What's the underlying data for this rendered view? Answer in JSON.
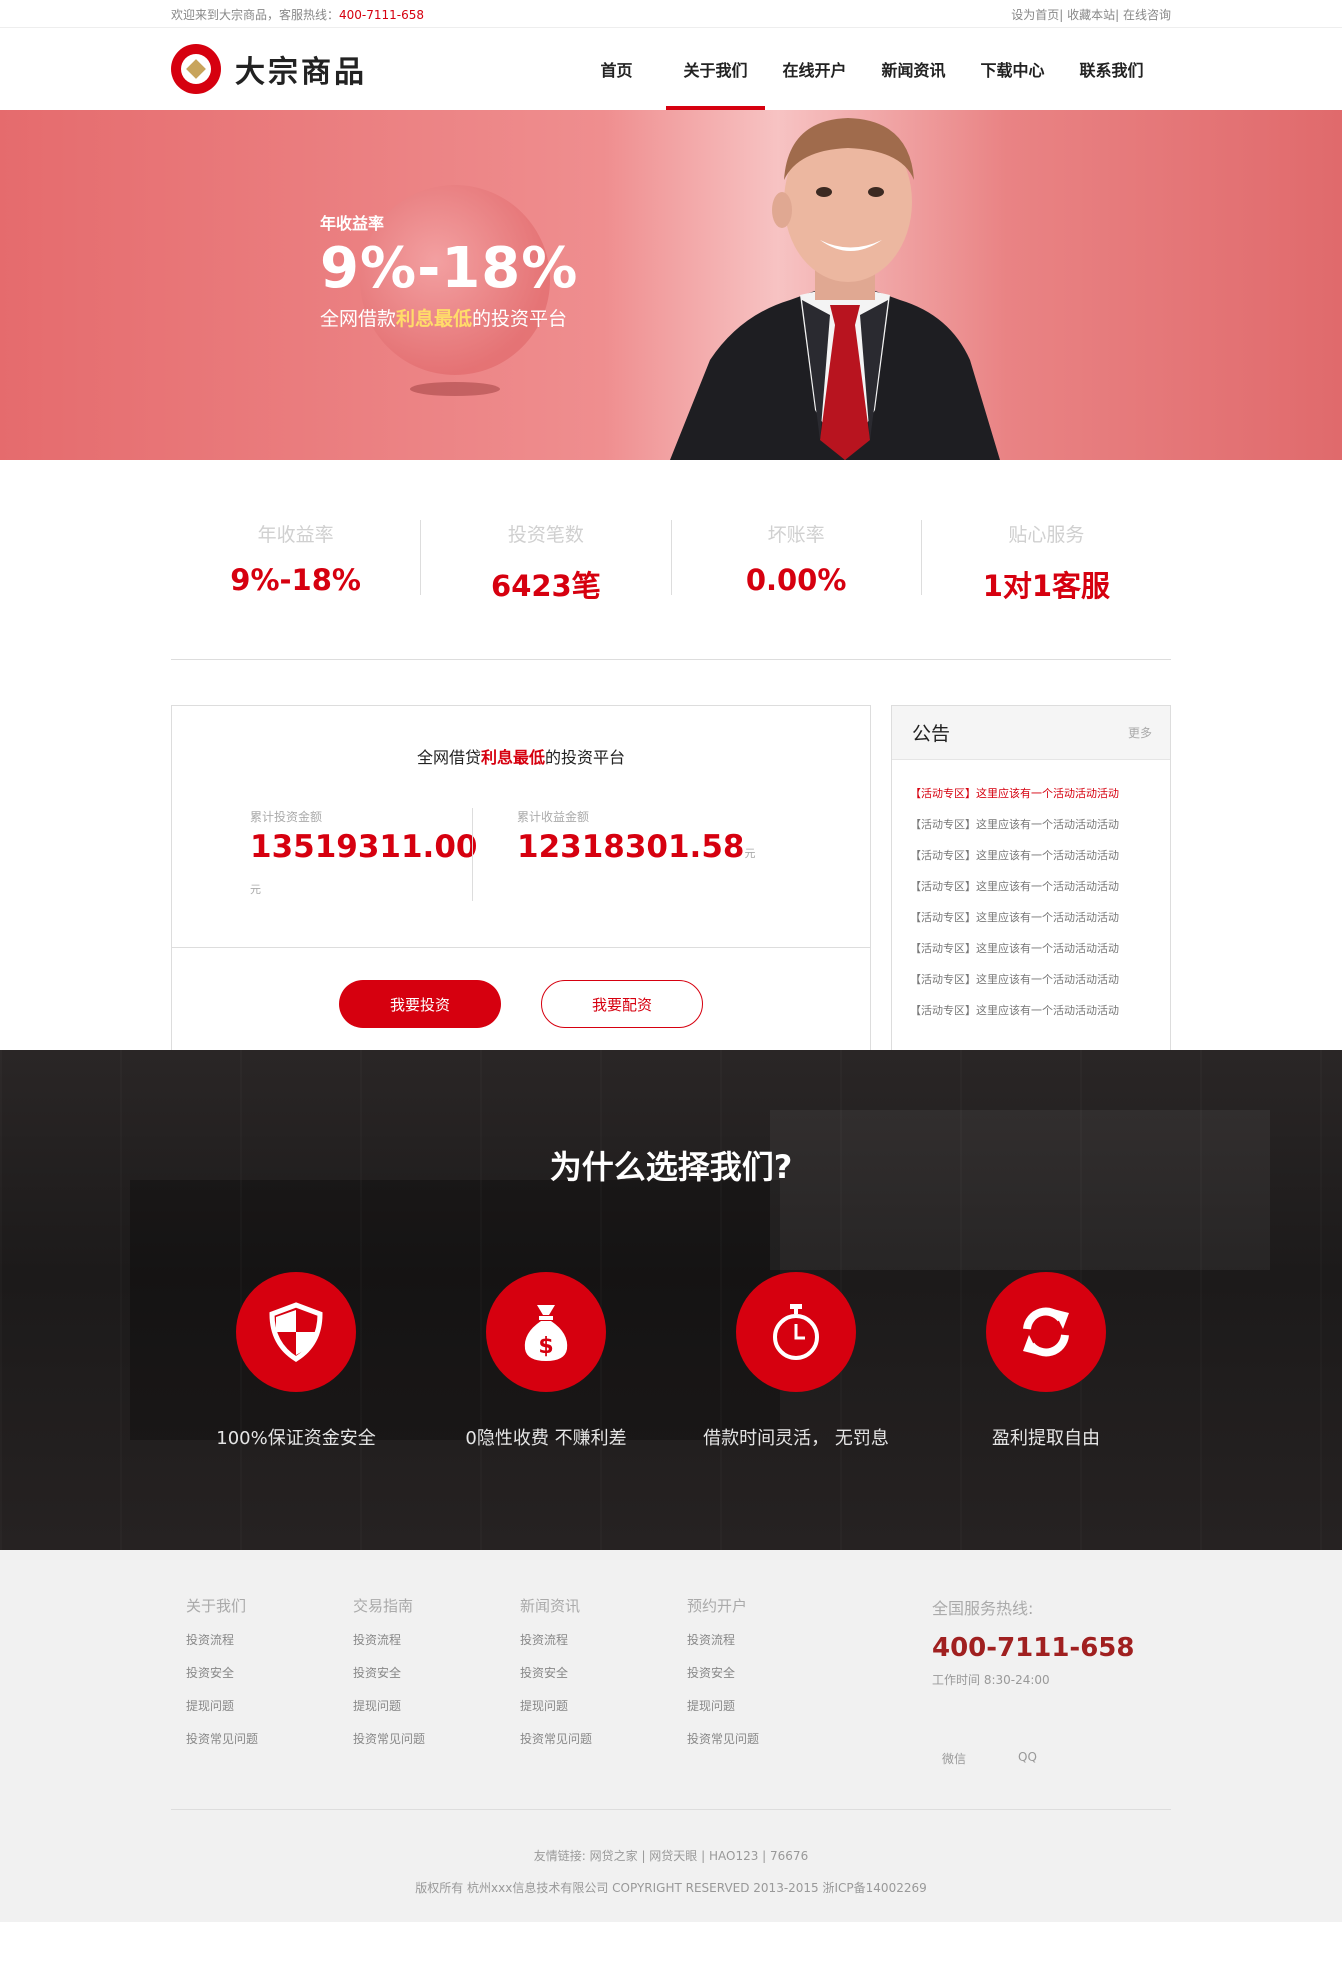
{
  "topbar": {
    "welcome": "欢迎来到大宗商品，客服热线：",
    "hotline": "400-7111-658",
    "links": [
      "设为首页",
      "收藏本站",
      "在线咨询"
    ],
    "sep": "|"
  },
  "header": {
    "logo_text": "大宗商品",
    "nav": [
      "首页",
      "关于我们",
      "在线开户",
      "新闻资讯",
      "下载中心",
      "联系我们"
    ],
    "active_nav": "关于我们"
  },
  "banner": {
    "label": "年收益率",
    "rate": "9%-18%",
    "sub_pre": "全网借款",
    "sub_hl": "利息最低",
    "sub_post": "的投资平台"
  },
  "stats": [
    {
      "title": "年收益率",
      "value": "9%-18%"
    },
    {
      "title": "投资笔数",
      "value": "6423笔"
    },
    {
      "title": "坏账率",
      "value": "0.00%"
    },
    {
      "title": "贴心服务",
      "value": "1对1客服"
    }
  ],
  "invest": {
    "title_pre": "全网借贷",
    "title_hl": "利息最低",
    "title_post": "的投资平台",
    "total_label": "累计投资金额",
    "total_value": "13519311.00",
    "income_label": "累计收益金额",
    "income_value": "12318301.58",
    "unit": "元",
    "btn_invest": "我要投资",
    "btn_alloc": "我要配资"
  },
  "notice": {
    "title": "公告",
    "more": "更多",
    "items": [
      "【活动专区】这里应该有一个活动活动活动",
      "【活动专区】这里应该有一个活动活动活动",
      "【活动专区】这里应该有一个活动活动活动",
      "【活动专区】这里应该有一个活动活动活动",
      "【活动专区】这里应该有一个活动活动活动",
      "【活动专区】这里应该有一个活动活动活动",
      "【活动专区】这里应该有一个活动活动活动",
      "【活动专区】这里应该有一个活动活动活动"
    ]
  },
  "why": {
    "title": "为什么选择我们?",
    "features": [
      {
        "icon": "shield-icon",
        "label": "100%保证资金安全"
      },
      {
        "icon": "money-bag-icon",
        "label": "0隐性收费 不赚利差"
      },
      {
        "icon": "stopwatch-icon",
        "label": "借款时间灵活， 无罚息"
      },
      {
        "icon": "refresh-icon",
        "label": "盈利提取自由"
      }
    ]
  },
  "footer": {
    "cols": [
      {
        "title": "关于我们",
        "links": [
          "投资流程",
          "投资安全",
          "提现问题",
          "投资常见问题"
        ]
      },
      {
        "title": "交易指南",
        "links": [
          "投资流程",
          "投资安全",
          "提现问题",
          "投资常见问题"
        ]
      },
      {
        "title": "新闻资讯",
        "links": [
          "投资流程",
          "投资安全",
          "提现问题",
          "投资常见问题"
        ]
      },
      {
        "title": "预约开户",
        "links": [
          "投资流程",
          "投资安全",
          "提现问题",
          "投资常见问题"
        ]
      }
    ],
    "hotline_title": "全国服务热线:",
    "hotline": "400-7111-658",
    "hours": "工作时间 8:30-24:00",
    "social": [
      "微信",
      "QQ"
    ],
    "friend_links": "友情链接: 网贷之家 | 网贷天眼 | HAO123 | 76676",
    "copyright": "版权所有 杭州xxx信息技术有限公司 COPYRIGHT RESERVED 2013-2015 浙ICP备14002269"
  },
  "colors": {
    "brand": "#d6000f",
    "dark": "#1c1a1a",
    "footer_bg": "#f1f1f1"
  }
}
